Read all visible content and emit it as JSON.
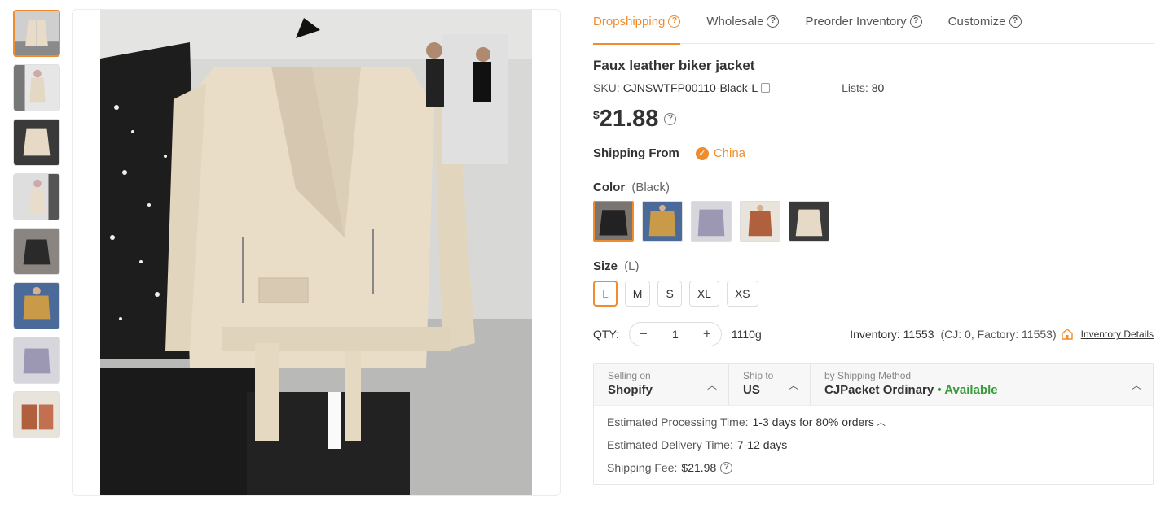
{
  "tabs": [
    {
      "label": "Dropshipping",
      "active": true
    },
    {
      "label": "Wholesale",
      "active": false
    },
    {
      "label": "Preorder Inventory",
      "active": false
    },
    {
      "label": "Customize",
      "active": false
    }
  ],
  "product": {
    "title": "Faux leather biker jacket",
    "sku_label": "SKU:",
    "sku": "CJNSWTFP00110-Black-L",
    "lists_label": "Lists:",
    "lists": "80",
    "currency": "$",
    "price": "21.88"
  },
  "shipping_from": {
    "label": "Shipping From",
    "country": "China"
  },
  "color": {
    "label": "Color",
    "selected": "(Black)"
  },
  "size": {
    "label": "Size",
    "selected": "(L)",
    "options": [
      "L",
      "M",
      "S",
      "XL",
      "XS"
    ]
  },
  "qty": {
    "label": "QTY:",
    "value": "1",
    "minus": "−",
    "plus": "+",
    "weight": "1110g"
  },
  "inventory": {
    "text": "Inventory: 11553",
    "breakdown": "(CJ: 0, Factory: 11553)",
    "link": "Inventory Details"
  },
  "ship_box": {
    "selling_label": "Selling on",
    "selling_value": "Shopify",
    "shipto_label": "Ship to",
    "shipto_value": "US",
    "method_label": "by Shipping Method",
    "method_value": "CJPacket Ordinary",
    "method_status": "• Available",
    "processing_label": "Estimated Processing Time:",
    "processing_value": "1-3 days for 80% orders",
    "delivery_label": "Estimated Delivery Time:",
    "delivery_value": "7-12 days",
    "fee_label": "Shipping Fee:",
    "fee_value": "$21.98"
  },
  "colors": {
    "accent": "#f08c2c",
    "available": "#3a9b3a"
  }
}
